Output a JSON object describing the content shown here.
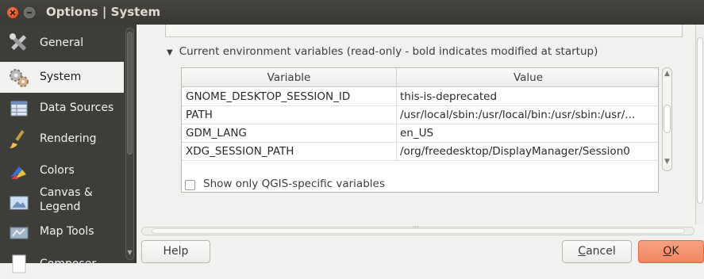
{
  "window": {
    "title": "Options | System"
  },
  "sidebar": {
    "items": [
      {
        "label": "General",
        "icon": "tools-icon"
      },
      {
        "label": "System",
        "icon": "gears-icon",
        "active": true
      },
      {
        "label": "Data Sources",
        "icon": "table-icon"
      },
      {
        "label": "Rendering",
        "icon": "brush-icon"
      },
      {
        "label": "Colors",
        "icon": "palette-icon"
      },
      {
        "label": "Canvas &",
        "label2": "Legend",
        "icon": "canvas-icon"
      },
      {
        "label": "Map Tools",
        "icon": "map-tools-icon"
      },
      {
        "label": "Composer",
        "icon": "composer-icon"
      }
    ]
  },
  "env_section": {
    "heading": "Current environment variables (read-only - bold indicates modified at startup)",
    "columns": [
      "Variable",
      "Value"
    ],
    "rows": [
      {
        "variable": "GNOME_DESKTOP_SESSION_ID",
        "value": "this-is-deprecated"
      },
      {
        "variable": "PATH",
        "value": "/usr/local/sbin:/usr/local/bin:/usr/sbin:/usr/..."
      },
      {
        "variable": "GDM_LANG",
        "value": "en_US"
      },
      {
        "variable": "XDG_SESSION_PATH",
        "value": "/org/freedesktop/DisplayManager/Session0"
      }
    ],
    "checkbox_label": "Show only QGIS-specific variables",
    "checkbox_checked": false
  },
  "buttons": {
    "help": "Help",
    "cancel": "Cancel",
    "ok": "OK"
  },
  "colors": {
    "sidebar_bg": "#3d3e3a",
    "accent_ok": "#f0865f",
    "close_button": "#e5552a"
  }
}
